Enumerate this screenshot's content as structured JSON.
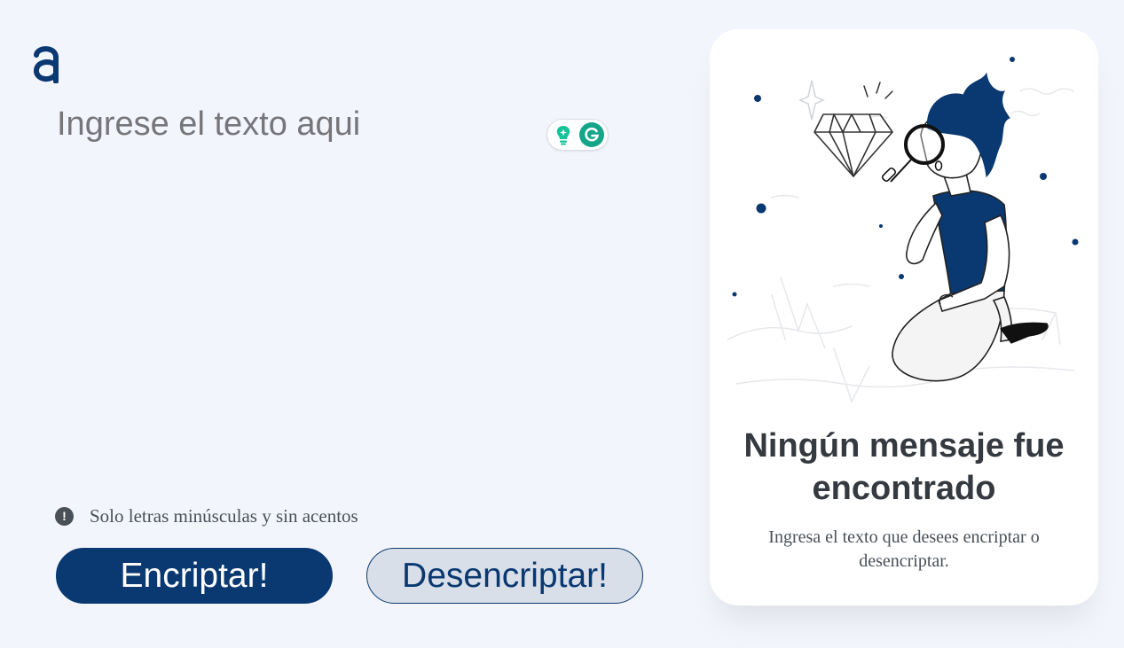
{
  "input": {
    "placeholder": "Ingrese el texto aqui",
    "value": ""
  },
  "hint": {
    "text": "Solo letras minúsculas y sin acentos",
    "icon": "exclamation-circle-icon"
  },
  "buttons": {
    "encrypt_label": "Encriptar!",
    "decrypt_label": "Desencriptar!"
  },
  "output": {
    "title": "Ningún mensaje fue encontrado",
    "subtitle": "Ingresa el texto que desees encriptar o desencriptar."
  },
  "colors": {
    "primary": "#0A3871",
    "background": "#F3F5FC",
    "secondary_button": "#D8DFE8",
    "text_dark": "#343A40",
    "text_muted": "#495057",
    "grammarly_green": "#15C39A"
  }
}
